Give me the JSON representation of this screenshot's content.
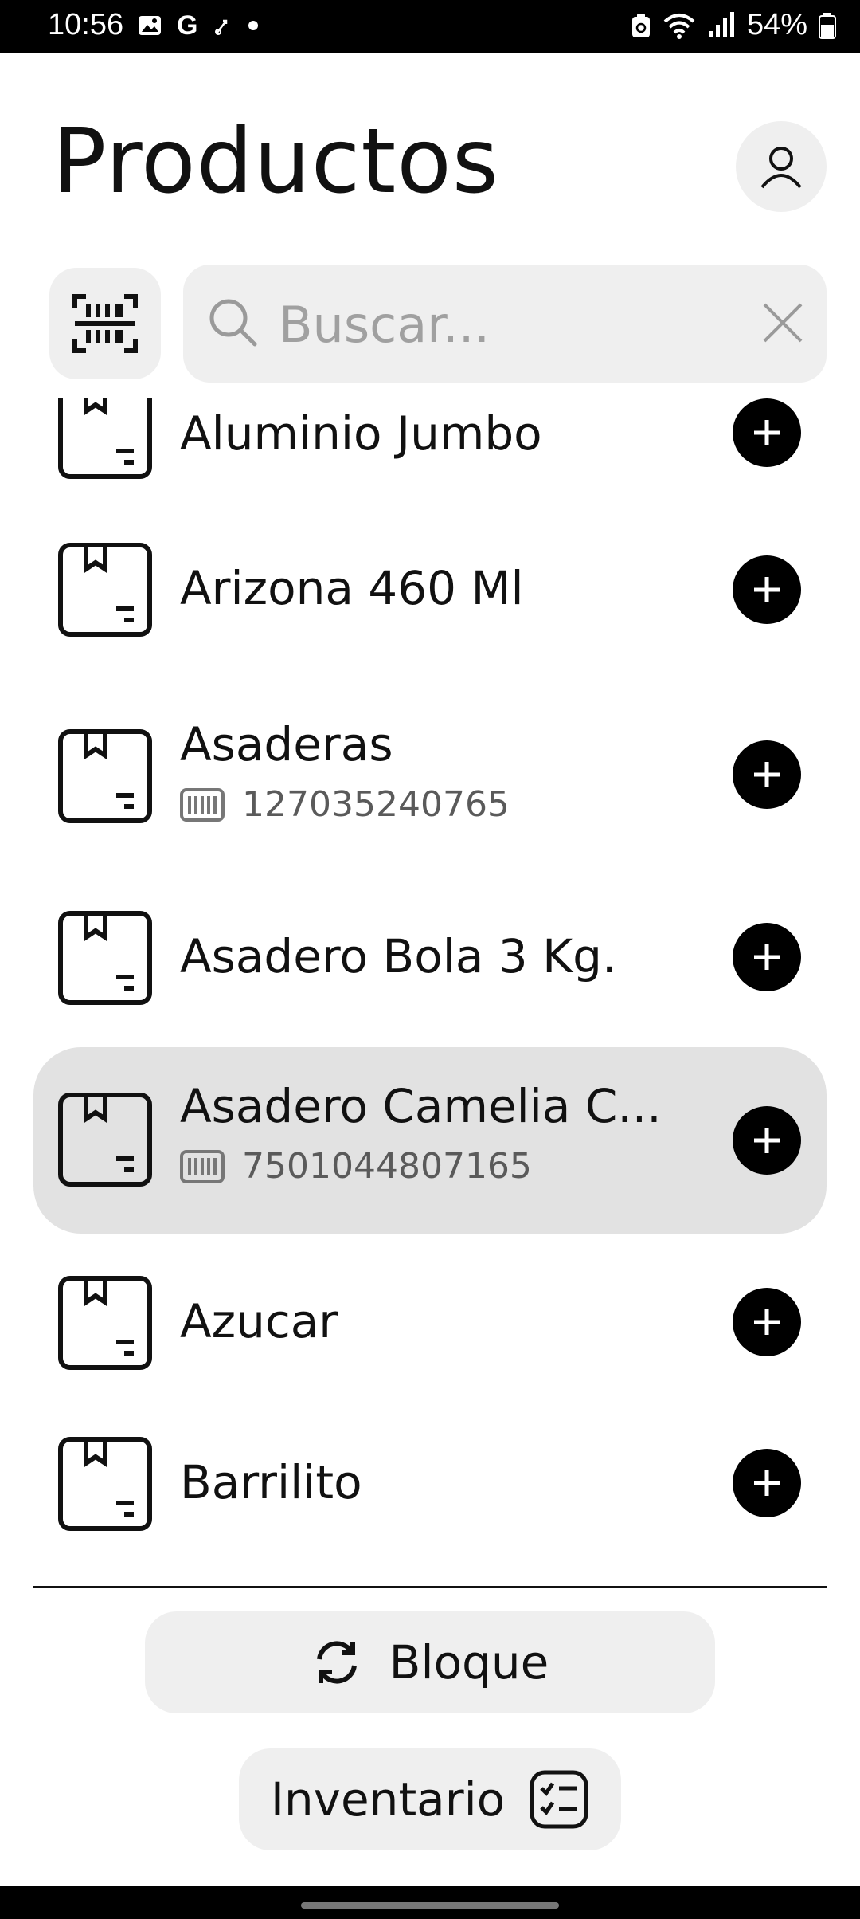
{
  "status_bar": {
    "time": "10:56",
    "battery": "54%",
    "left_icons": [
      "image-icon",
      "google-icon",
      "accessibility-icon",
      "dot-icon"
    ],
    "right_icons": [
      "recycle-icon",
      "wifi-icon",
      "signal-icon",
      "battery-icon"
    ]
  },
  "header": {
    "title": "Productos"
  },
  "search": {
    "placeholder": "Buscar..."
  },
  "products": [
    {
      "name": "Aluminio Jumbo",
      "code": ""
    },
    {
      "name": "Arizona 460 Ml",
      "code": ""
    },
    {
      "name": "Asaderas",
      "code": "127035240765"
    },
    {
      "name": "Asadero Bola 3 Kg.",
      "code": ""
    },
    {
      "name": "Asadero Camelia C...",
      "code": "7501044807165"
    },
    {
      "name": "Azucar",
      "code": ""
    },
    {
      "name": "Barrilito",
      "code": ""
    }
  ],
  "actions": {
    "bloque_label": "Bloque",
    "inventario_label": "Inventario"
  },
  "colors": {
    "accent": "#000000",
    "surface": "#efefef",
    "selected": "#e2e2e2"
  }
}
